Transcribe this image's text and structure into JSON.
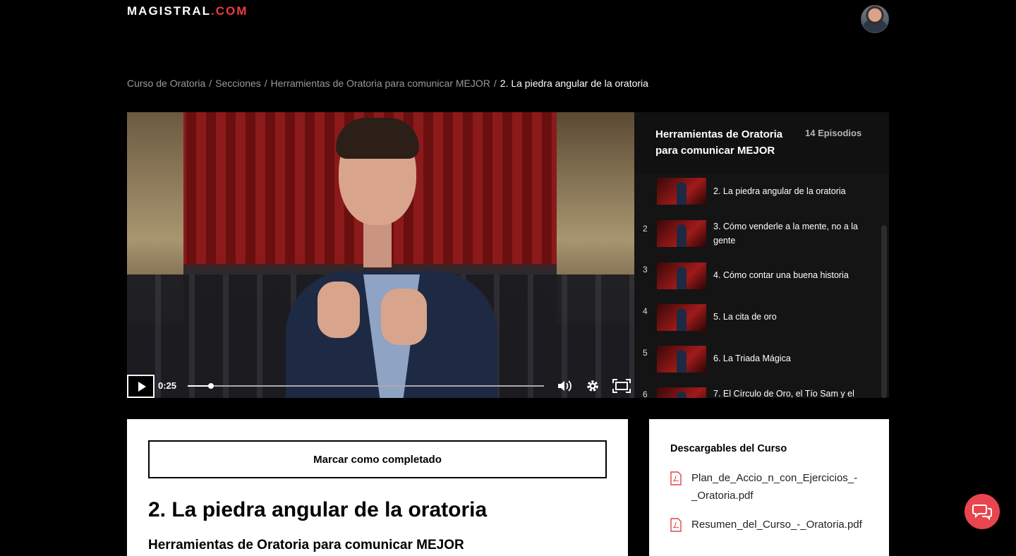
{
  "brand": {
    "logo_main": "MAGISTRAL",
    "logo_suffix": ".COM"
  },
  "breadcrumb": {
    "items": [
      "Curso de Oratoria",
      "Secciones",
      "Herramientas de Oratoria para comunicar MEJOR"
    ],
    "separator": "/",
    "current": "2. La piedra angular de la oratoria"
  },
  "player": {
    "time": "0:25",
    "progress": 0.065
  },
  "playlist": {
    "title": "Herramientas de Oratoria para comunicar MEJOR",
    "count": "14 Episodios",
    "episodes": [
      {
        "num": "",
        "title": "2. La piedra angular de la oratoria"
      },
      {
        "num": "2",
        "title": "3. Cómo venderle a la mente, no a la gente"
      },
      {
        "num": "3",
        "title": "4. Cómo contar una buena historia"
      },
      {
        "num": "4",
        "title": "5. La cita de oro"
      },
      {
        "num": "5",
        "title": "6. La Triada Mágica"
      },
      {
        "num": "6",
        "title": "7. El Círculo de Oro, el Tío Sam y el"
      }
    ]
  },
  "lesson": {
    "complete_label": "Marcar como completado",
    "title": "2. La piedra angular de la oratoria",
    "section": "Herramientas de Oratoria para comunicar MEJOR"
  },
  "downloads": {
    "title": "Descargables del Curso",
    "files": [
      "Plan_de_Accio_n_con_Ejercicios_-_Oratoria.pdf",
      "Resumen_del_Curso_-_Oratoria.pdf"
    ]
  },
  "colors": {
    "accent": "#ef3b3b",
    "chat": "#e9454f",
    "background": "#000000"
  },
  "icons": {
    "play": "play-icon",
    "volume": "volume-icon",
    "settings": "gear-icon",
    "fullscreen": "fullscreen-icon",
    "pdf": "pdf-file-icon",
    "chat": "chat-bubbles-icon"
  }
}
